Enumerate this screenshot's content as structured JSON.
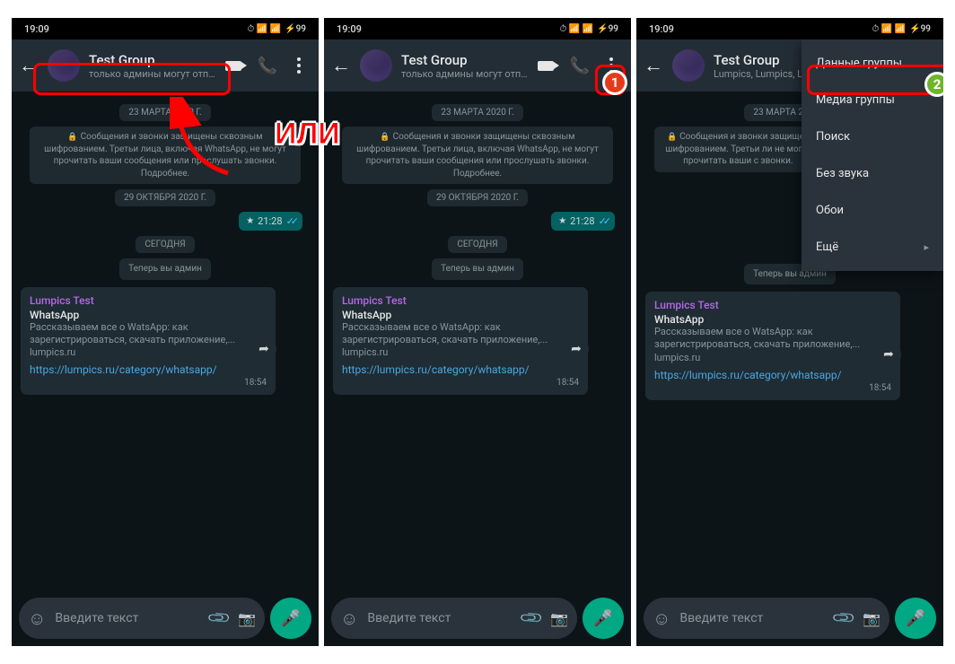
{
  "statusbar": {
    "time": "19:09",
    "battery": "99"
  },
  "header": {
    "title": "Test Group",
    "subtitle_truncated": "только админы могут отпра...",
    "subtitle_members": "Lumpics, Lumpics, L"
  },
  "chat": {
    "date1": "23 МАРТА 2020 Г.",
    "encryption_notice": "Сообщения и звонки защищены сквозным шифрованием. Третьи лица, включая WhatsApp, не могут прочитать ваши сообщения или прослушать звонки. Подробнее.",
    "date2": "29 ОКТЯБРЯ 2020 Г.",
    "out_time": "21:28",
    "today": "СЕГОДНЯ",
    "admin_notice": "Теперь вы админ",
    "card": {
      "sender": "Lumpics Test",
      "title": "WhatsApp",
      "desc": "Рассказываем все о WatsApp: как зарегистрироваться, скачать приложение,...",
      "site": "lumpics.ru",
      "link": "https://lumpics.ru/category/whatsapp/",
      "time": "18:54"
    }
  },
  "input": {
    "placeholder": "Введите текст"
  },
  "annotation": {
    "or_label": "ИЛИ",
    "badge1": "1",
    "badge2": "2"
  },
  "menu": {
    "item1": "Данные группы",
    "item2": "Медиа группы",
    "item3": "Поиск",
    "item4": "Без звука",
    "item5": "Обои",
    "item6": "Ещё"
  }
}
